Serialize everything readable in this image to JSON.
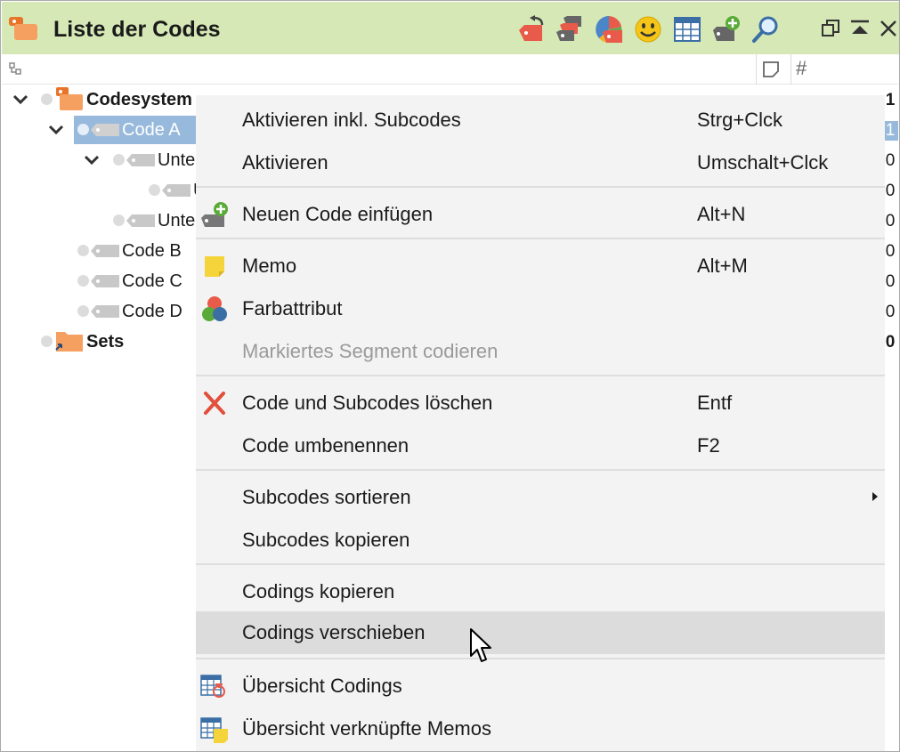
{
  "window": {
    "title": "Liste der Codes"
  },
  "toolbar": {
    "icons": [
      "code-back-icon",
      "code-colors-icon",
      "code-chart-icon",
      "smiley-icon",
      "table-icon",
      "new-code-icon",
      "search-icon"
    ],
    "window_controls": [
      "restore-icon",
      "collapse-icon",
      "close-icon"
    ]
  },
  "columns": {
    "memo_icon": "note-icon",
    "count_header": "#"
  },
  "tree": {
    "root": {
      "label": "Codesystem",
      "count": "1"
    },
    "items": [
      {
        "label": "Code A",
        "count": "1"
      },
      {
        "label": "Unte",
        "count": "0"
      },
      {
        "label": "U",
        "count": "0"
      },
      {
        "label": "Unte",
        "count": "0"
      },
      {
        "label": "Code B",
        "count": "0"
      },
      {
        "label": "Code C",
        "count": "0"
      },
      {
        "label": "Code D",
        "count": "0"
      }
    ],
    "sets": {
      "label": "Sets",
      "count": "0"
    }
  },
  "context_menu": {
    "items": [
      {
        "label": "Aktivieren inkl. Subcodes",
        "shortcut": "Strg+Clck"
      },
      {
        "label": "Aktivieren",
        "shortcut": "Umschalt+Clck"
      },
      {
        "label": "Neuen Code einfügen",
        "shortcut": "Alt+N",
        "icon": "new-code-icon"
      },
      {
        "label": "Memo",
        "shortcut": "Alt+M",
        "icon": "memo-icon"
      },
      {
        "label": "Farbattribut",
        "shortcut": "",
        "icon": "color-attribute-icon"
      },
      {
        "label": "Markiertes Segment codieren",
        "shortcut": "",
        "disabled": true
      },
      {
        "label": "Code und Subcodes löschen",
        "shortcut": "Entf",
        "icon": "delete-icon"
      },
      {
        "label": "Code umbenennen",
        "shortcut": "F2"
      },
      {
        "label": "Subcodes sortieren",
        "shortcut": "",
        "has_submenu": true
      },
      {
        "label": "Subcodes kopieren",
        "shortcut": ""
      },
      {
        "label": "Codings kopieren",
        "shortcut": ""
      },
      {
        "label": "Codings verschieben",
        "shortcut": "",
        "hovered": true
      },
      {
        "label": "Übersicht Codings",
        "shortcut": "",
        "icon": "codings-overview-icon"
      },
      {
        "label": "Übersicht verknüpfte Memos",
        "shortcut": "",
        "icon": "memos-overview-icon"
      }
    ]
  },
  "colors": {
    "titlebar_bg": "#d5e8b5",
    "selection": "#97b9dc",
    "menu_bg": "#f3f3f3",
    "menu_hover": "#dcdcdc",
    "code_orange": "#f0902f",
    "delete_red": "#e0503c"
  }
}
